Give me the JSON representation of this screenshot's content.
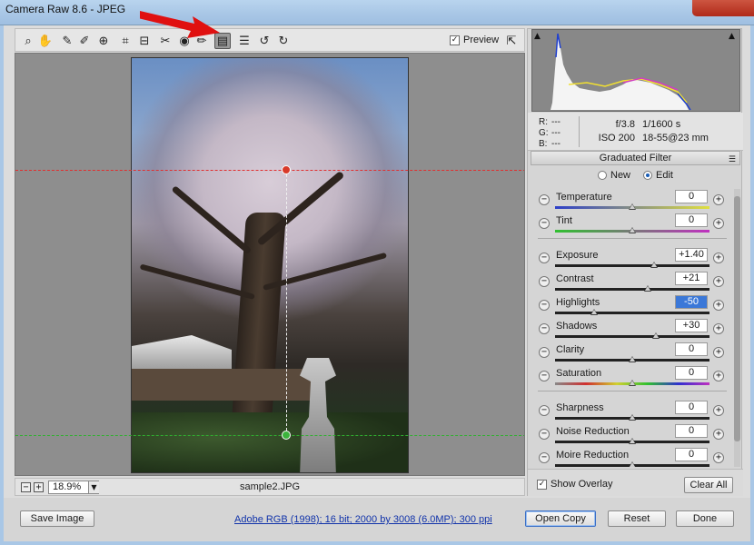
{
  "window": {
    "title": "Camera Raw 8.6  -  JPEG"
  },
  "toolbar": {
    "tools": [
      {
        "icon": "zoom-icon",
        "glyph": "⌕"
      },
      {
        "icon": "hand-icon",
        "glyph": "✋"
      },
      {
        "icon": "white-balance-icon",
        "glyph": "✎"
      },
      {
        "icon": "color-sampler-icon",
        "glyph": "✐"
      },
      {
        "icon": "targeted-adjustment-icon",
        "glyph": "⊕"
      },
      {
        "icon": "crop-icon",
        "glyph": "⌗"
      },
      {
        "icon": "straighten-icon",
        "glyph": "⊟"
      },
      {
        "icon": "spot-removal-icon",
        "glyph": "✂"
      },
      {
        "icon": "red-eye-icon",
        "glyph": "◉"
      },
      {
        "icon": "adjustment-brush-icon",
        "glyph": "✏"
      },
      {
        "icon": "graduated-filter-icon",
        "glyph": "▤"
      },
      {
        "icon": "preferences-icon",
        "glyph": "☰"
      },
      {
        "icon": "rotate-ccw-icon",
        "glyph": "↺"
      },
      {
        "icon": "rotate-cw-icon",
        "glyph": "↻"
      }
    ],
    "preview_label": "Preview",
    "preview_checked": "✓"
  },
  "canvas": {
    "zoom_value": "18.9%",
    "filename": "sample2.JPG"
  },
  "info": {
    "r_label": "R:",
    "r_value": "---",
    "g_label": "G:",
    "g_value": "---",
    "b_label": "B:",
    "b_value": "---",
    "aperture": "f/3.8",
    "shutter": "1/1600 s",
    "iso": "ISO 200",
    "lens": "18-55@23 mm"
  },
  "panel": {
    "section_title": "Graduated Filter",
    "mode_new": "New",
    "mode_edit": "Edit",
    "sliders": [
      {
        "label": "Temperature",
        "value": "0",
        "pos": 0.5
      },
      {
        "label": "Tint",
        "value": "0",
        "pos": 0.5
      },
      {
        "label": "Exposure",
        "value": "+1.40",
        "pos": 0.64
      },
      {
        "label": "Contrast",
        "value": "+21",
        "pos": 0.6
      },
      {
        "label": "Highlights",
        "value": "-50",
        "pos": 0.25
      },
      {
        "label": "Shadows",
        "value": "+30",
        "pos": 0.65
      },
      {
        "label": "Clarity",
        "value": "0",
        "pos": 0.5
      },
      {
        "label": "Saturation",
        "value": "0",
        "pos": 0.5
      },
      {
        "label": "Sharpness",
        "value": "0",
        "pos": 0.5
      },
      {
        "label": "Noise Reduction",
        "value": "0",
        "pos": 0.5
      },
      {
        "label": "Moire Reduction",
        "value": "0",
        "pos": 0.5
      }
    ],
    "show_overlay_label": "Show Overlay",
    "show_overlay_checked": "✓",
    "clear_all_label": "Clear All"
  },
  "bottom": {
    "save_label": "Save Image",
    "info_link": "Adobe RGB (1998); 16 bit; 2000 by 3008 (6.0MP); 300 ppi",
    "open_label": "Open Copy",
    "reset_label": "Reset",
    "done_label": "Done"
  },
  "colors": {
    "guide_top": "#e03030",
    "guide_bottom": "#30b030",
    "accent": "#3b78d8"
  }
}
